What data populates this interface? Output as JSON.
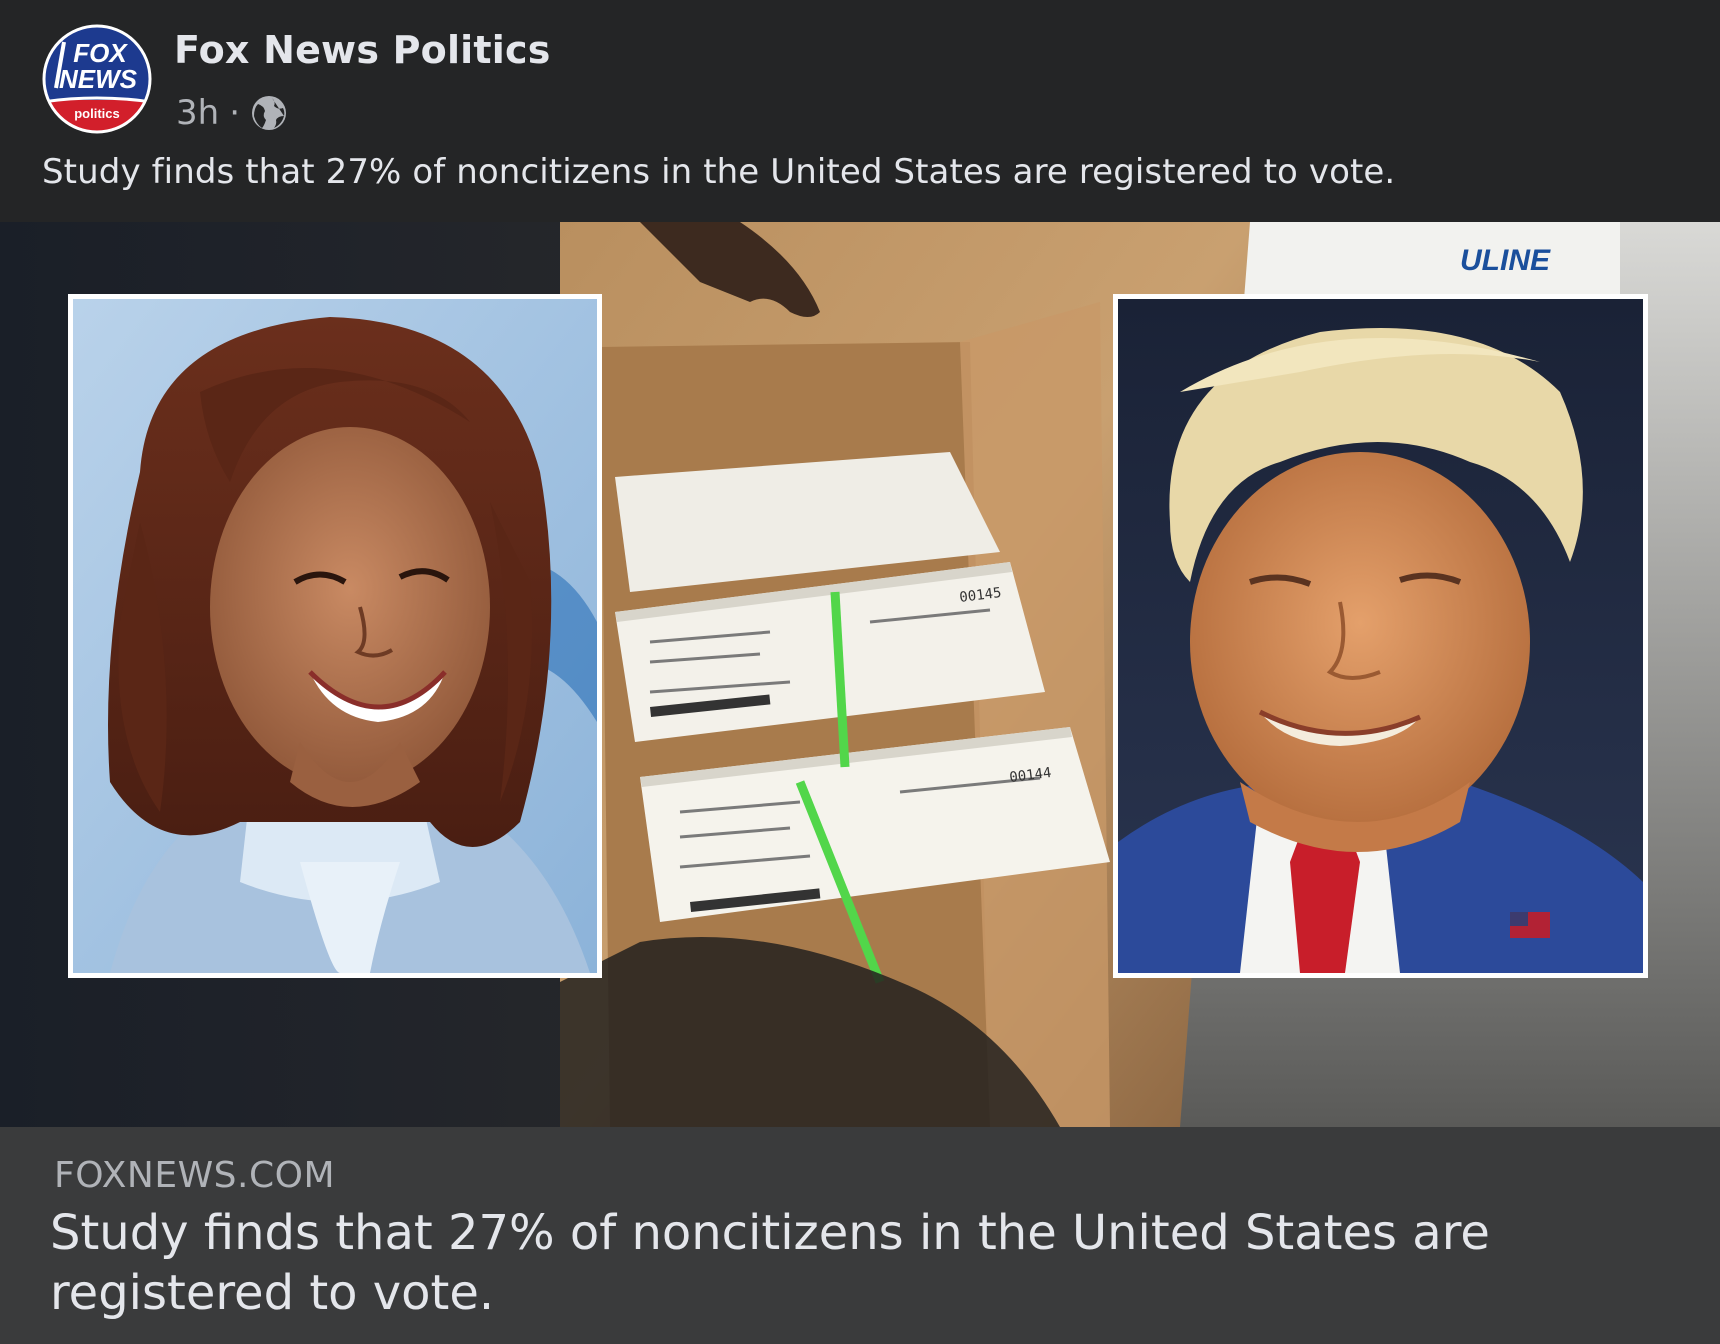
{
  "post": {
    "page_name": "Fox News Politics",
    "timestamp": "3h",
    "separator": "·",
    "caption": "Study finds that 27% of noncitizens in the United States are registered to vote."
  },
  "logo": {
    "line1": "FOX",
    "line2": "NEWS",
    "line3": "politics"
  },
  "image": {
    "box_brand": "ULINE",
    "ballot_numbers": [
      "00145",
      "00144"
    ]
  },
  "link_card": {
    "domain": "FOXNEWS.COM",
    "title": "Study finds that 27% of noncitizens in the United States are registered to vote."
  },
  "icons": {
    "audience": "globe-icon"
  },
  "colors": {
    "background": "#242526",
    "card_footer": "#3a3b3c",
    "primary_text": "#e4e6eb",
    "secondary_text": "#b0b3b8",
    "fox_blue": "#1d3a8f",
    "fox_red": "#d21f2b"
  }
}
